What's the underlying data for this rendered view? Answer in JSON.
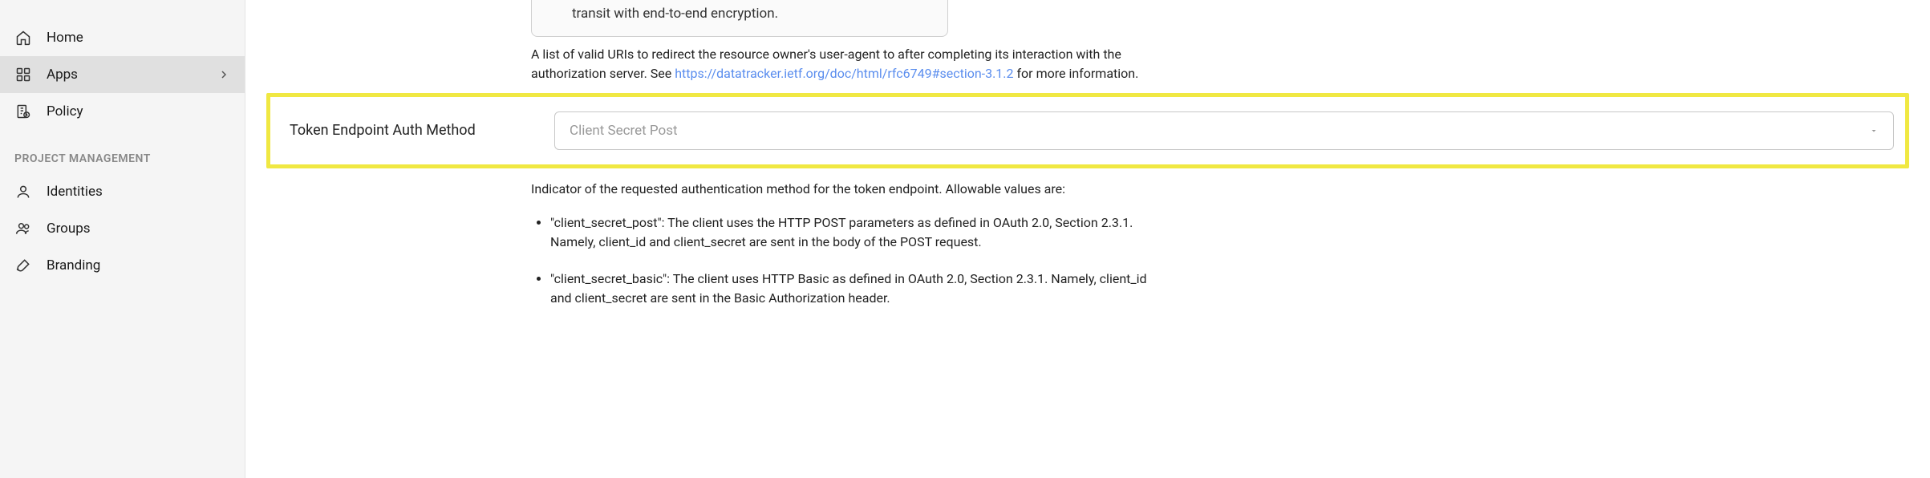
{
  "sidebar": {
    "items": [
      {
        "label": "Home"
      },
      {
        "label": "Apps"
      },
      {
        "label": "Policy"
      }
    ],
    "section_title": "PROJECT MANAGEMENT",
    "pm_items": [
      {
        "label": "Identities"
      },
      {
        "label": "Groups"
      },
      {
        "label": "Branding"
      }
    ]
  },
  "tip": {
    "text": "transit with end-to-end encryption."
  },
  "redirect_desc": {
    "prefix": "A list of valid URIs to redirect the resource owner's user-agent to after completing its interaction with the authorization server. See ",
    "link_text": "https://datatracker.ietf.org/doc/html/rfc6749#section-3.1.2",
    "suffix": " for more information."
  },
  "auth_method": {
    "label": "Token Endpoint Auth Method",
    "placeholder": "Client Secret Post",
    "help": "Indicator of the requested authentication method for the token endpoint. Allowable values are:",
    "bullets": [
      "\"client_secret_post\": The client uses the HTTP POST parameters as defined in OAuth 2.0, Section 2.3.1. Namely, client_id and client_secret are sent in the body of the POST request.",
      "\"client_secret_basic\": The client uses HTTP Basic as defined in OAuth 2.0, Section 2.3.1. Namely, client_id and client_secret are sent in the Basic Authorization header."
    ]
  }
}
